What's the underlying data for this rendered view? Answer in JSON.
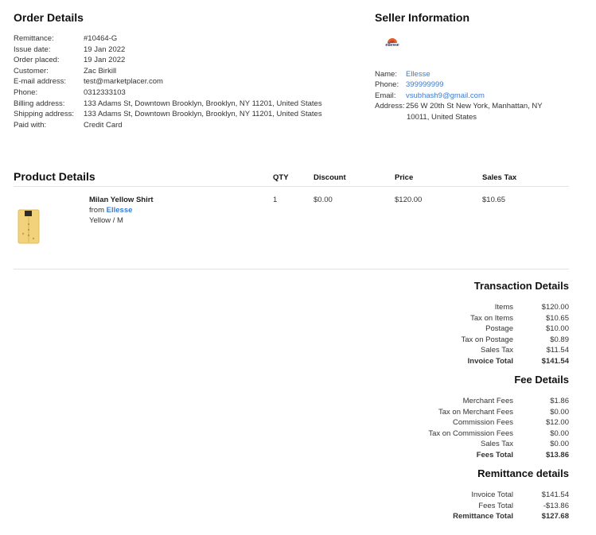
{
  "order": {
    "title": "Order Details",
    "rows": [
      {
        "label": "Remittance:",
        "value": "#10464-G"
      },
      {
        "label": "Issue date:",
        "value": "19 Jan 2022"
      },
      {
        "label": "Order placed:",
        "value": "19 Jan 2022"
      },
      {
        "label": "Customer:",
        "value": "Zac Birkill"
      },
      {
        "label": "E-mail address:",
        "value": "test@marketplacer.com"
      },
      {
        "label": "Phone:",
        "value": "0312333103"
      },
      {
        "label": "Billing address:",
        "value": "133 Adams St, Downtown Brooklyn, Brooklyn, NY 11201, United States"
      },
      {
        "label": "Shipping address:",
        "value": "133 Adams St, Downtown Brooklyn, Brooklyn, NY 11201, United States"
      },
      {
        "label": "Paid with:",
        "value": "Credit Card"
      }
    ]
  },
  "seller": {
    "title": "Seller Information",
    "logo_text": "ellesse",
    "name_label": "Name:",
    "name": "Ellesse",
    "phone_label": "Phone:",
    "phone": "399999999",
    "email_label": "Email:",
    "email": "vsubhash9@gmail.com",
    "address_label": "Address:",
    "address_line1": "256 W 20th St New York, Manhattan, NY",
    "address_line2": "10011, United States"
  },
  "products": {
    "title": "Product Details",
    "headers": {
      "qty": "QTY",
      "discount": "Discount",
      "price": "Price",
      "sales_tax": "Sales Tax"
    },
    "items": [
      {
        "name": "Milan Yellow Shirt",
        "from": "from",
        "brand": "Ellesse",
        "variant": "Yellow / M",
        "qty": "1",
        "discount": "$0.00",
        "price": "$120.00",
        "sales_tax": "$10.65"
      }
    ]
  },
  "transaction": {
    "title": "Transaction Details",
    "rows": [
      {
        "label": "Items",
        "value": "$120.00"
      },
      {
        "label": "Tax on Items",
        "value": "$10.65"
      },
      {
        "label": "Postage",
        "value": "$10.00"
      },
      {
        "label": "Tax on Postage",
        "value": "$0.89"
      },
      {
        "label": "Sales Tax",
        "value": "$11.54"
      },
      {
        "label": "Invoice Total",
        "value": "$141.54"
      }
    ]
  },
  "fees": {
    "title": "Fee Details",
    "rows": [
      {
        "label": "Merchant Fees",
        "value": "$1.86"
      },
      {
        "label": "Tax on Merchant Fees",
        "value": "$0.00"
      },
      {
        "label": "Commission Fees",
        "value": "$12.00"
      },
      {
        "label": "Tax on Commission Fees",
        "value": "$0.00"
      },
      {
        "label": "Sales Tax",
        "value": "$0.00"
      },
      {
        "label": "Fees Total",
        "value": "$13.86"
      }
    ]
  },
  "remittance": {
    "title": "Remittance details",
    "rows": [
      {
        "label": "Invoice Total",
        "value": "$141.54"
      },
      {
        "label": "Fees Total",
        "value": "-$13.86"
      },
      {
        "label": "Remittance Total",
        "value": "$127.68"
      }
    ]
  },
  "colors": {
    "link": "#3a7bd5",
    "shirt": "#f2d27a",
    "rule": "#e2e2e2"
  }
}
